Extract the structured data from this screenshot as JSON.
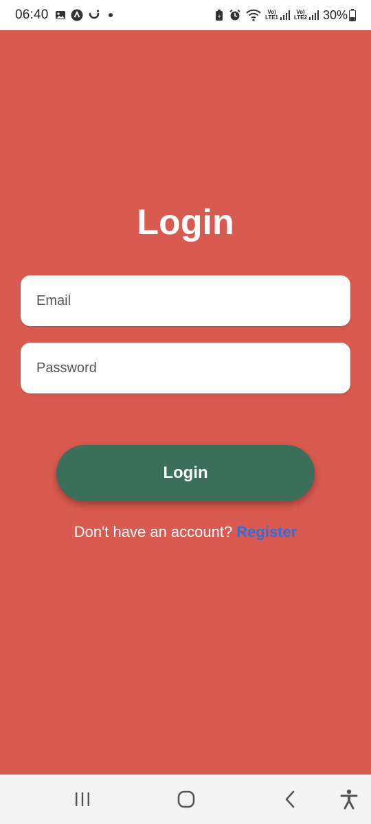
{
  "status_bar": {
    "time": "06:40",
    "sim1_label": [
      "Vo)",
      "LTE1"
    ],
    "sim2_label": [
      "Vo)",
      "LTE2"
    ],
    "battery": "30%"
  },
  "login": {
    "title": "Login",
    "email_placeholder": "Email",
    "password_placeholder": "Password",
    "button_label": "Login",
    "no_account_text": "Don't have an account?",
    "register_link": "Register"
  },
  "colors": {
    "background": "#d95a50",
    "button": "#3b6e5b",
    "link": "#2f6fdd"
  },
  "nav_bar": {
    "icons": [
      "recent-apps-icon",
      "home-icon",
      "back-icon",
      "accessibility-icon"
    ]
  }
}
